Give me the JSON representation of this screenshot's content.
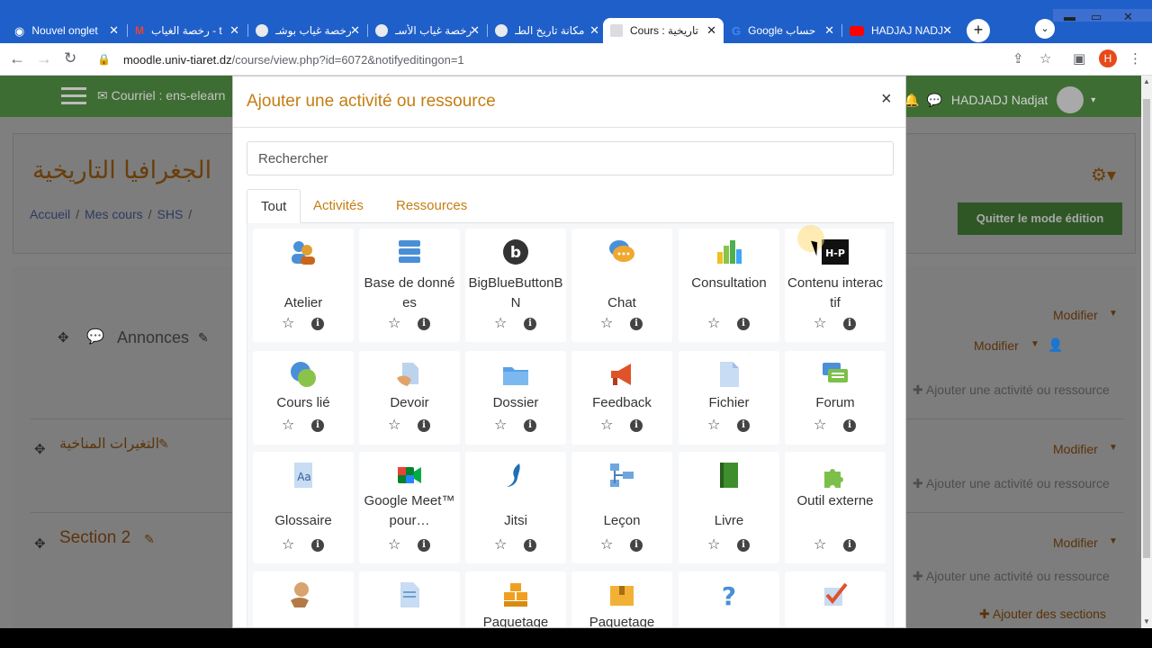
{
  "browser": {
    "tabs": [
      {
        "title": "Nouvel onglet",
        "favicon": "chrome-icon",
        "active": false
      },
      {
        "title": "رخصة الغياب - t",
        "favicon": "gmail-icon",
        "active": false
      },
      {
        "title": "رخصة غياب بوشـ",
        "favicon": "globe-icon",
        "active": false
      },
      {
        "title": "رخصة غياب الأسـ",
        "favicon": "globe-icon",
        "active": false
      },
      {
        "title": "مكانة تاريخ الطـ",
        "favicon": "globe-icon",
        "active": false
      },
      {
        "title": "Cours : تاريخية",
        "favicon": "moodle-icon",
        "active": true
      },
      {
        "title": "Google حساب",
        "favicon": "google-icon",
        "active": false
      },
      {
        "title": "HADJAJ NADJ",
        "favicon": "youtube-icon",
        "active": false
      }
    ],
    "new_tab": "+",
    "url_host": "moodle.univ-tiaret.dz",
    "url_path": "/course/view.php?id=6072&notifyeditingon=1",
    "profile_initial": "H"
  },
  "moodle": {
    "header_mail": "✉ Courriel : ens-elearn",
    "user_name": "HADJADJ Nadjat",
    "course_title": "الجغرافيا التاريخية",
    "breadcrumb": [
      "Accueil",
      "Mes cours",
      "SHS"
    ],
    "quit_edit_label": "Quitter le mode édition",
    "sections": [
      {
        "title": "Annonces"
      },
      {
        "title": "التغيرات المناخية"
      },
      {
        "title": "Section 2"
      }
    ],
    "modify_label": "Modifier",
    "add_activity_label": "Ajouter une activité ou ressource",
    "add_sections_label": "Ajouter des sections"
  },
  "modal": {
    "title": "Ajouter une activité ou ressource",
    "close": "×",
    "search_placeholder": "Rechercher",
    "tabs": [
      "Tout",
      "Activités",
      "Ressources"
    ],
    "activities": [
      {
        "name": "Atelier",
        "icon": "workshop-icon"
      },
      {
        "name": "Base de données",
        "icon": "database-icon"
      },
      {
        "name": "BigBlueButtonBN",
        "icon": "bigbluebutton-icon"
      },
      {
        "name": "Chat",
        "icon": "chat-icon"
      },
      {
        "name": "Consultation",
        "icon": "chart-icon"
      },
      {
        "name": "Contenu interactif",
        "icon": "h5p-icon"
      },
      {
        "name": "Cours lié",
        "icon": "linked-course-icon"
      },
      {
        "name": "Devoir",
        "icon": "assignment-icon"
      },
      {
        "name": "Dossier",
        "icon": "folder-icon"
      },
      {
        "name": "Feedback",
        "icon": "megaphone-icon"
      },
      {
        "name": "Fichier",
        "icon": "file-icon"
      },
      {
        "name": "Forum",
        "icon": "forum-icon"
      },
      {
        "name": "Glossaire",
        "icon": "glossary-icon"
      },
      {
        "name": "Google Meet™ pour…",
        "icon": "google-meet-icon"
      },
      {
        "name": "Jitsi",
        "icon": "jitsi-icon"
      },
      {
        "name": "Leçon",
        "icon": "lesson-icon"
      },
      {
        "name": "Livre",
        "icon": "book-icon"
      },
      {
        "name": "Outil externe",
        "icon": "puzzle-icon"
      },
      {
        "name": "",
        "icon": "hand-paper-icon"
      },
      {
        "name": "",
        "icon": "page-icon"
      },
      {
        "name": "Paquetage",
        "icon": "package-icon"
      },
      {
        "name": "Paquetage",
        "icon": "package-box-icon"
      },
      {
        "name": "",
        "icon": "question-icon"
      },
      {
        "name": "",
        "icon": "checkmark-icon"
      }
    ],
    "star_glyph": "☆",
    "info_glyph": "i"
  }
}
